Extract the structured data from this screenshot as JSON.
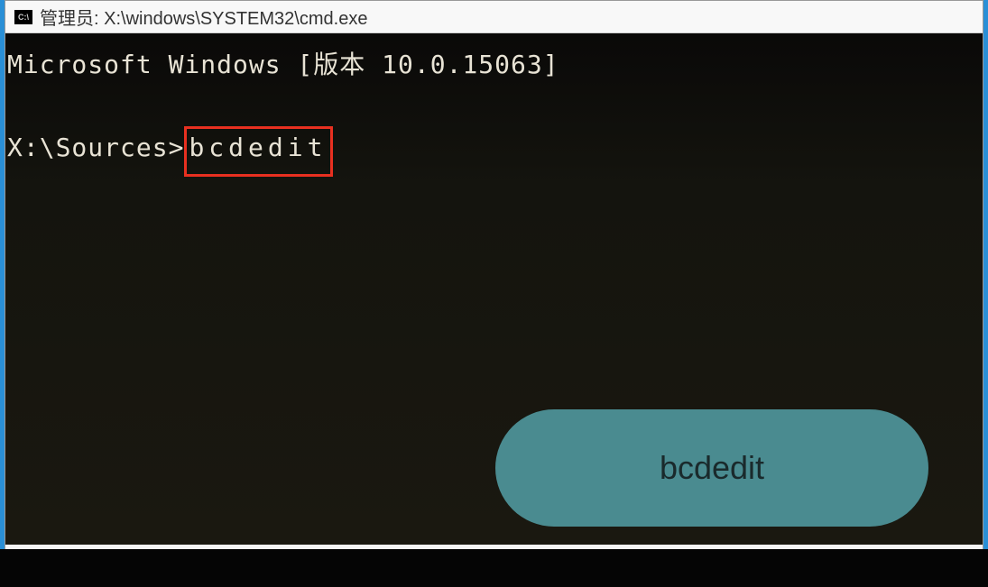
{
  "window": {
    "icon_label": "C:\\",
    "title": "管理员: X:\\windows\\SYSTEM32\\cmd.exe"
  },
  "terminal": {
    "version_line": "Microsoft Windows [版本 10.0.15063]",
    "prompt": "X:\\Sources>",
    "command": "bcdedit"
  },
  "callout": {
    "label": "bcdedit"
  }
}
